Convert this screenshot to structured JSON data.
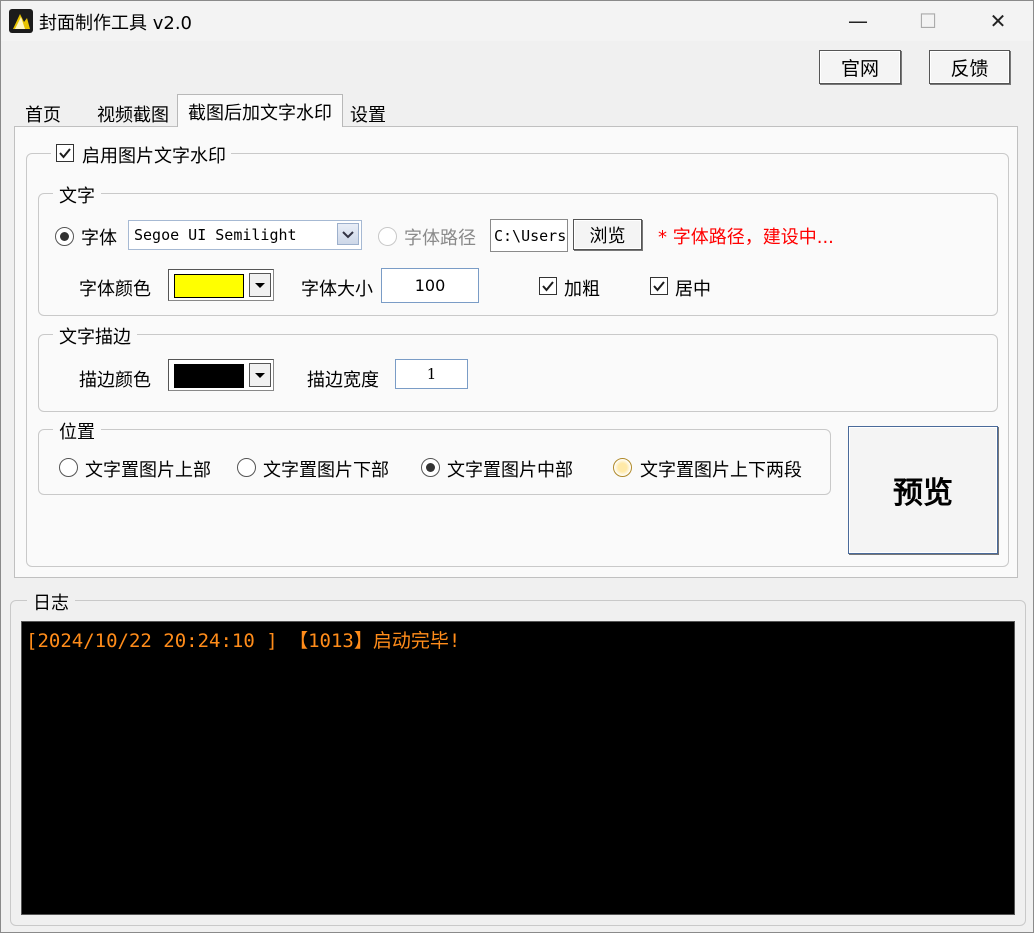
{
  "window": {
    "title": "封面制作工具  v2.0",
    "minimize": "—",
    "maximize": "☐",
    "close": "✕"
  },
  "top_buttons": {
    "website": "官网",
    "feedback": "反馈"
  },
  "tabs": [
    {
      "label": "首页"
    },
    {
      "label": "视频截图"
    },
    {
      "label": "截图后加文字水印"
    },
    {
      "label": "设置"
    }
  ],
  "watermark": {
    "enable_label": "启用图片文字水印",
    "enabled": true,
    "text_group": {
      "title": "文字",
      "font_radio": "字体",
      "font_value": "Segoe UI Semilight",
      "font_path_radio": "字体路径",
      "font_path_value": "C:\\Users",
      "browse": "浏览",
      "note": "* 字体路径，建设中...",
      "font_color_label": "字体颜色",
      "font_color": "#ffff00",
      "font_size_label": "字体大小",
      "font_size": "100",
      "bold_label": "加粗",
      "center_label": "居中"
    },
    "stroke_group": {
      "title": "文字描边",
      "stroke_color_label": "描边颜色",
      "stroke_color": "#000000",
      "stroke_width_label": "描边宽度",
      "stroke_width": "1"
    },
    "position_group": {
      "title": "位置",
      "options": [
        "文字置图片上部",
        "文字置图片下部",
        "文字置图片中部",
        "文字置图片上下两段"
      ],
      "selected": "文字置图片中部"
    },
    "preview": "预览"
  },
  "log": {
    "title": "日志",
    "lines": [
      "[2024/10/22 20:24:10 ]  【1013】启动完毕!"
    ]
  },
  "colors": {
    "log_text": "#ff8c1a",
    "note_red": "#ff0000",
    "accent_blue": "#2a5fa8"
  }
}
